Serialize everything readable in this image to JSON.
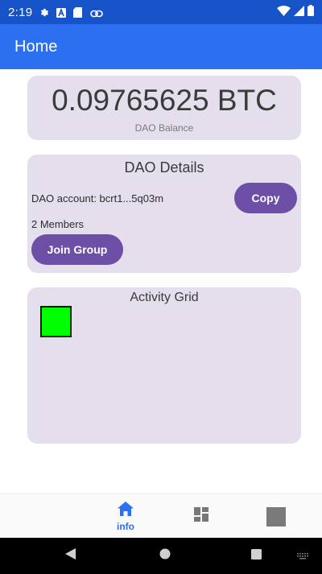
{
  "status_bar": {
    "time": "2:19"
  },
  "app_bar": {
    "title": "Home"
  },
  "balance_card": {
    "value": "0.09765625 BTC",
    "label": "DAO Balance"
  },
  "details_card": {
    "title": "DAO Details",
    "account": "DAO account: bcrt1...5q03m",
    "copy_label": "Copy",
    "members": "2 Members",
    "join_label": "Join Group"
  },
  "activity_card": {
    "title": "Activity Grid",
    "cell_color": "#00ff00"
  },
  "bottom_nav": {
    "items": [
      {
        "icon": "home-icon",
        "label": "info",
        "active": true
      },
      {
        "icon": "dashboard-icon"
      },
      {
        "icon": "square-icon"
      }
    ],
    "active_color": "#2c6ff0"
  },
  "colors": {
    "status_bar": "#1753c8",
    "app_bar": "#2c6ff0",
    "card": "#e5deec",
    "button": "#6d4fa7"
  }
}
